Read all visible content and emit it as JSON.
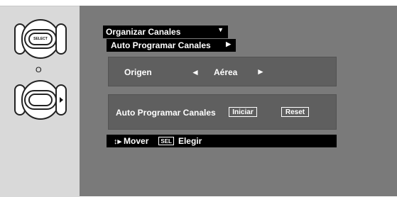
{
  "remote": {
    "select_label": "SELECT",
    "or_label": "O"
  },
  "menu": {
    "title": "Organizar Canales",
    "title_caret": "▼",
    "submenu_label": "Auto Programar Canales",
    "submenu_caret": "▶"
  },
  "origin": {
    "label": "Origen",
    "left_arrow": "◄",
    "value": "Aérea",
    "right_arrow": "►"
  },
  "autoprogram": {
    "label": "Auto Programar Canales",
    "start_button": "Iniciar",
    "reset_button": "Reset"
  },
  "footer": {
    "move_icon": "↕▸",
    "move_label": "Mover",
    "sel_badge": "SEL",
    "select_label": "Elegir"
  }
}
